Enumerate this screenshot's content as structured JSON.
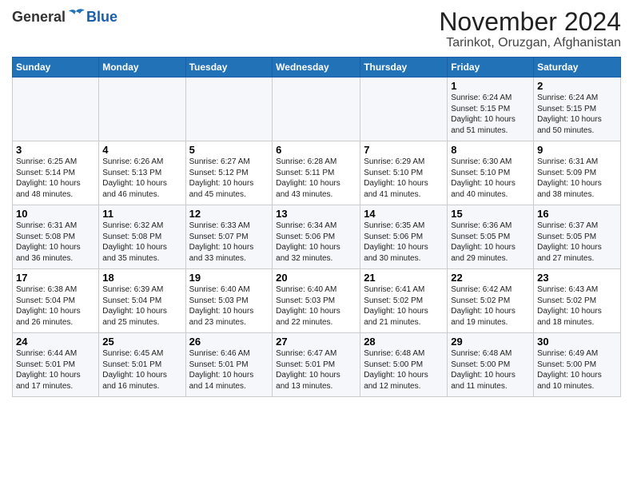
{
  "header": {
    "logo_general": "General",
    "logo_blue": "Blue",
    "month": "November 2024",
    "location": "Tarinkot, Oruzgan, Afghanistan"
  },
  "weekdays": [
    "Sunday",
    "Monday",
    "Tuesday",
    "Wednesday",
    "Thursday",
    "Friday",
    "Saturday"
  ],
  "weeks": [
    [
      {
        "day": "",
        "info": ""
      },
      {
        "day": "",
        "info": ""
      },
      {
        "day": "",
        "info": ""
      },
      {
        "day": "",
        "info": ""
      },
      {
        "day": "",
        "info": ""
      },
      {
        "day": "1",
        "info": "Sunrise: 6:24 AM\nSunset: 5:15 PM\nDaylight: 10 hours\nand 51 minutes."
      },
      {
        "day": "2",
        "info": "Sunrise: 6:24 AM\nSunset: 5:15 PM\nDaylight: 10 hours\nand 50 minutes."
      }
    ],
    [
      {
        "day": "3",
        "info": "Sunrise: 6:25 AM\nSunset: 5:14 PM\nDaylight: 10 hours\nand 48 minutes."
      },
      {
        "day": "4",
        "info": "Sunrise: 6:26 AM\nSunset: 5:13 PM\nDaylight: 10 hours\nand 46 minutes."
      },
      {
        "day": "5",
        "info": "Sunrise: 6:27 AM\nSunset: 5:12 PM\nDaylight: 10 hours\nand 45 minutes."
      },
      {
        "day": "6",
        "info": "Sunrise: 6:28 AM\nSunset: 5:11 PM\nDaylight: 10 hours\nand 43 minutes."
      },
      {
        "day": "7",
        "info": "Sunrise: 6:29 AM\nSunset: 5:10 PM\nDaylight: 10 hours\nand 41 minutes."
      },
      {
        "day": "8",
        "info": "Sunrise: 6:30 AM\nSunset: 5:10 PM\nDaylight: 10 hours\nand 40 minutes."
      },
      {
        "day": "9",
        "info": "Sunrise: 6:31 AM\nSunset: 5:09 PM\nDaylight: 10 hours\nand 38 minutes."
      }
    ],
    [
      {
        "day": "10",
        "info": "Sunrise: 6:31 AM\nSunset: 5:08 PM\nDaylight: 10 hours\nand 36 minutes."
      },
      {
        "day": "11",
        "info": "Sunrise: 6:32 AM\nSunset: 5:08 PM\nDaylight: 10 hours\nand 35 minutes."
      },
      {
        "day": "12",
        "info": "Sunrise: 6:33 AM\nSunset: 5:07 PM\nDaylight: 10 hours\nand 33 minutes."
      },
      {
        "day": "13",
        "info": "Sunrise: 6:34 AM\nSunset: 5:06 PM\nDaylight: 10 hours\nand 32 minutes."
      },
      {
        "day": "14",
        "info": "Sunrise: 6:35 AM\nSunset: 5:06 PM\nDaylight: 10 hours\nand 30 minutes."
      },
      {
        "day": "15",
        "info": "Sunrise: 6:36 AM\nSunset: 5:05 PM\nDaylight: 10 hours\nand 29 minutes."
      },
      {
        "day": "16",
        "info": "Sunrise: 6:37 AM\nSunset: 5:05 PM\nDaylight: 10 hours\nand 27 minutes."
      }
    ],
    [
      {
        "day": "17",
        "info": "Sunrise: 6:38 AM\nSunset: 5:04 PM\nDaylight: 10 hours\nand 26 minutes."
      },
      {
        "day": "18",
        "info": "Sunrise: 6:39 AM\nSunset: 5:04 PM\nDaylight: 10 hours\nand 25 minutes."
      },
      {
        "day": "19",
        "info": "Sunrise: 6:40 AM\nSunset: 5:03 PM\nDaylight: 10 hours\nand 23 minutes."
      },
      {
        "day": "20",
        "info": "Sunrise: 6:40 AM\nSunset: 5:03 PM\nDaylight: 10 hours\nand 22 minutes."
      },
      {
        "day": "21",
        "info": "Sunrise: 6:41 AM\nSunset: 5:02 PM\nDaylight: 10 hours\nand 21 minutes."
      },
      {
        "day": "22",
        "info": "Sunrise: 6:42 AM\nSunset: 5:02 PM\nDaylight: 10 hours\nand 19 minutes."
      },
      {
        "day": "23",
        "info": "Sunrise: 6:43 AM\nSunset: 5:02 PM\nDaylight: 10 hours\nand 18 minutes."
      }
    ],
    [
      {
        "day": "24",
        "info": "Sunrise: 6:44 AM\nSunset: 5:01 PM\nDaylight: 10 hours\nand 17 minutes."
      },
      {
        "day": "25",
        "info": "Sunrise: 6:45 AM\nSunset: 5:01 PM\nDaylight: 10 hours\nand 16 minutes."
      },
      {
        "day": "26",
        "info": "Sunrise: 6:46 AM\nSunset: 5:01 PM\nDaylight: 10 hours\nand 14 minutes."
      },
      {
        "day": "27",
        "info": "Sunrise: 6:47 AM\nSunset: 5:01 PM\nDaylight: 10 hours\nand 13 minutes."
      },
      {
        "day": "28",
        "info": "Sunrise: 6:48 AM\nSunset: 5:00 PM\nDaylight: 10 hours\nand 12 minutes."
      },
      {
        "day": "29",
        "info": "Sunrise: 6:48 AM\nSunset: 5:00 PM\nDaylight: 10 hours\nand 11 minutes."
      },
      {
        "day": "30",
        "info": "Sunrise: 6:49 AM\nSunset: 5:00 PM\nDaylight: 10 hours\nand 10 minutes."
      }
    ]
  ]
}
